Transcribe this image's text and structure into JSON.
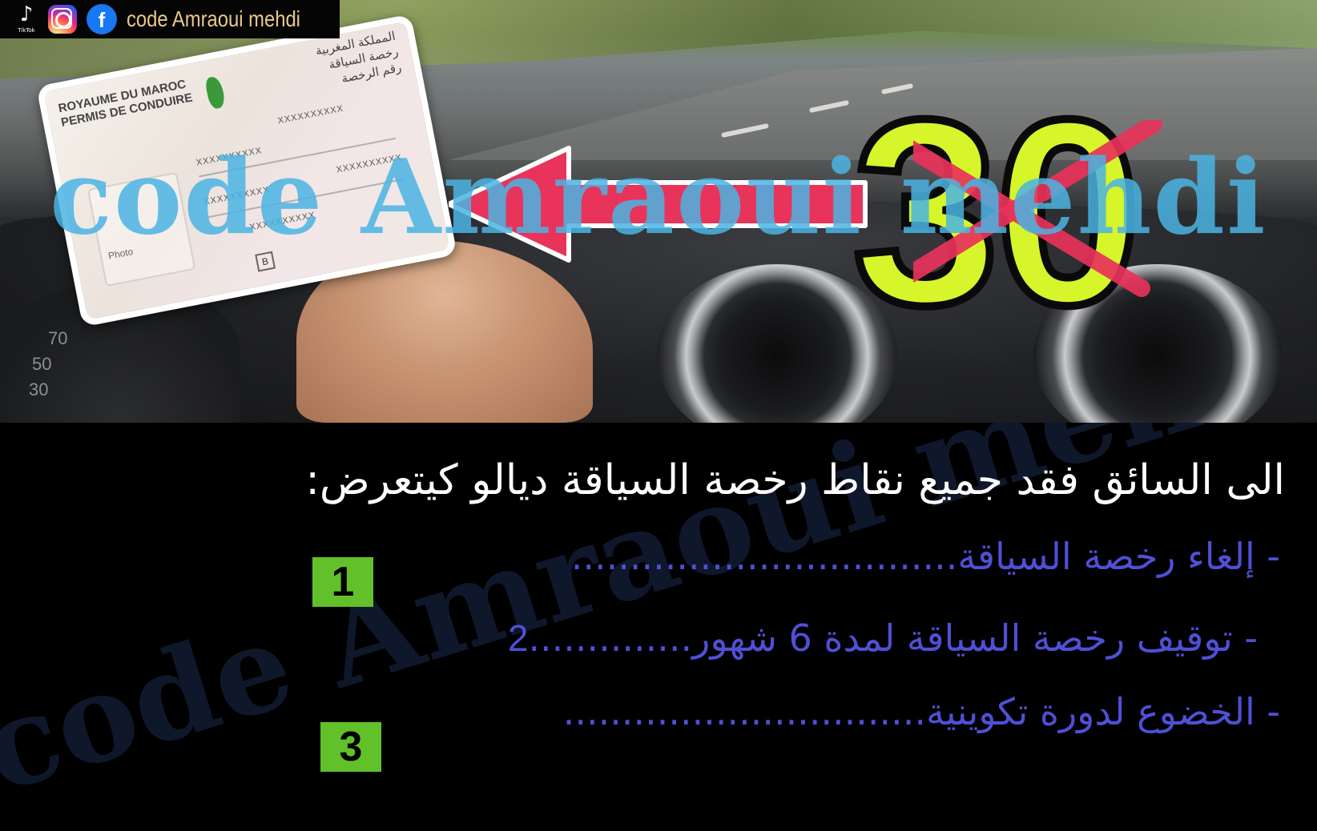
{
  "social": {
    "tiktok_label": "TikTok",
    "facebook_letter": "f",
    "channel_name": "code Amraoui mehdi"
  },
  "license": {
    "fr_line1": "ROYAUME DU MAROC",
    "fr_line2": "PERMIS DE CONDUIRE",
    "ar_line1": "المملكة المغربية",
    "ar_line2": "رخصة السياقة",
    "ar_line3": "رقم الرخصة",
    "number_mask": "XXXXXXXXXX",
    "photo_label": "Photo",
    "category": "B"
  },
  "overlay": {
    "watermark": "code Amraoui mehdi",
    "points_number": "30"
  },
  "question": {
    "text": "الى السائق فقد جميع نقاط رخصة السياقة ديالو كيتعرض:"
  },
  "options": [
    {
      "text": "- إلغاء رخصة السياقة",
      "dots": ".................................",
      "number": "1",
      "selected": true
    },
    {
      "text": "- توقيف رخصة السياقة لمدة 6 شهور",
      "dots": "..............",
      "number": "2",
      "selected": false
    },
    {
      "text": "- الخضوع لدورة تكوينية",
      "dots": "...............................",
      "number": "3",
      "selected": true
    }
  ],
  "colors": {
    "badge_green": "#62c12a",
    "option_blue": "#4f4fd6",
    "number_yellow": "#d6f52a",
    "cross_red": "#e8335a",
    "watermark_blue": "#4bb4e3"
  }
}
